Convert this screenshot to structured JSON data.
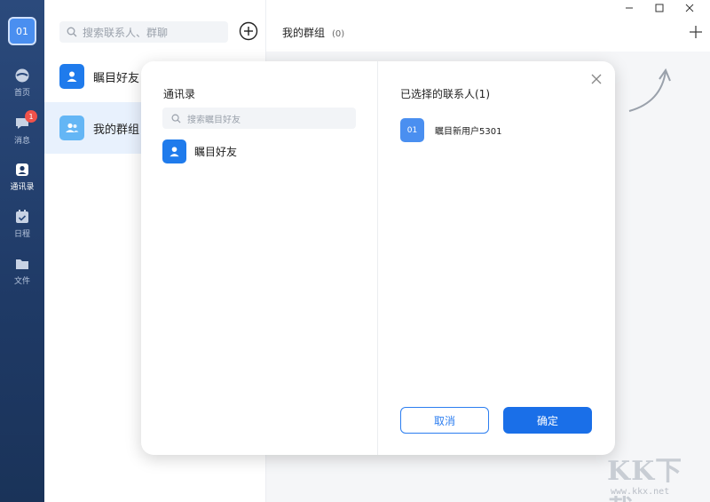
{
  "rail": {
    "avatar_text": "01",
    "nav": [
      {
        "label": "首页",
        "icon": "home-icon"
      },
      {
        "label": "消息",
        "icon": "message-icon",
        "badge": "1"
      },
      {
        "label": "通讯录",
        "icon": "contacts-icon"
      },
      {
        "label": "日程",
        "icon": "calendar-icon"
      },
      {
        "label": "文件",
        "icon": "folder-icon"
      }
    ]
  },
  "list": {
    "search_placeholder": "搜索联系人、群聊",
    "items": [
      {
        "label": "瞩目好友",
        "icon": "user-icon"
      },
      {
        "label": "我的群组",
        "icon": "group-icon"
      }
    ]
  },
  "header": {
    "title": "我的群组",
    "count": "(0)"
  },
  "modal": {
    "left_title": "通讯录",
    "search_placeholder": "搜索瞩目好友",
    "contact_label": "瞩目好友",
    "right_title": "已选择的联系人(1)",
    "selected": [
      {
        "avatar_text": "01",
        "name": "瞩目新用户5301"
      }
    ],
    "cancel_label": "取消",
    "ok_label": "确定"
  },
  "watermark": {
    "text": "KK下载",
    "url": "www.kkx.net"
  },
  "colors": {
    "accent": "#1a6fe8",
    "rail": "#1f3a66",
    "badge": "#f0524a"
  }
}
